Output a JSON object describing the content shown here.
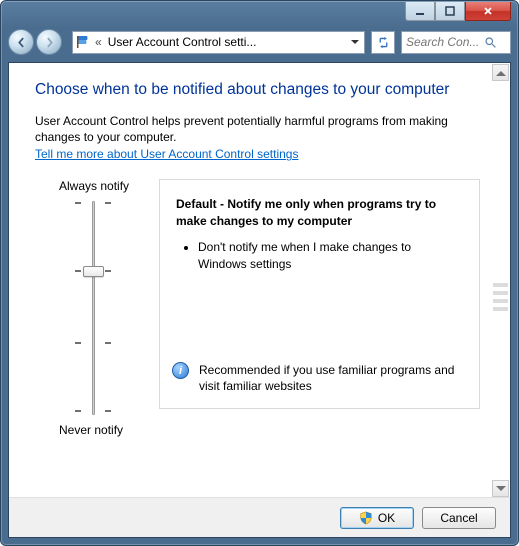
{
  "breadcrumb": {
    "text": "User Account Control setti..."
  },
  "search": {
    "placeholder": "Search Con..."
  },
  "heading": "Choose when to be notified about changes to your computer",
  "intro": "User Account Control helps prevent potentially harmful programs from making changes to your computer.",
  "help_link": "Tell me more about User Account Control settings",
  "slider": {
    "label_top": "Always notify",
    "label_bottom": "Never notify",
    "levels": 4,
    "current_level": 2
  },
  "description": {
    "title": "Default - Notify me only when programs try to make changes to my computer",
    "bullets": [
      "Don't notify me when I make changes to Windows settings"
    ],
    "recommendation": "Recommended if you use familiar programs and visit familiar websites"
  },
  "buttons": {
    "ok": "OK",
    "cancel": "Cancel"
  }
}
